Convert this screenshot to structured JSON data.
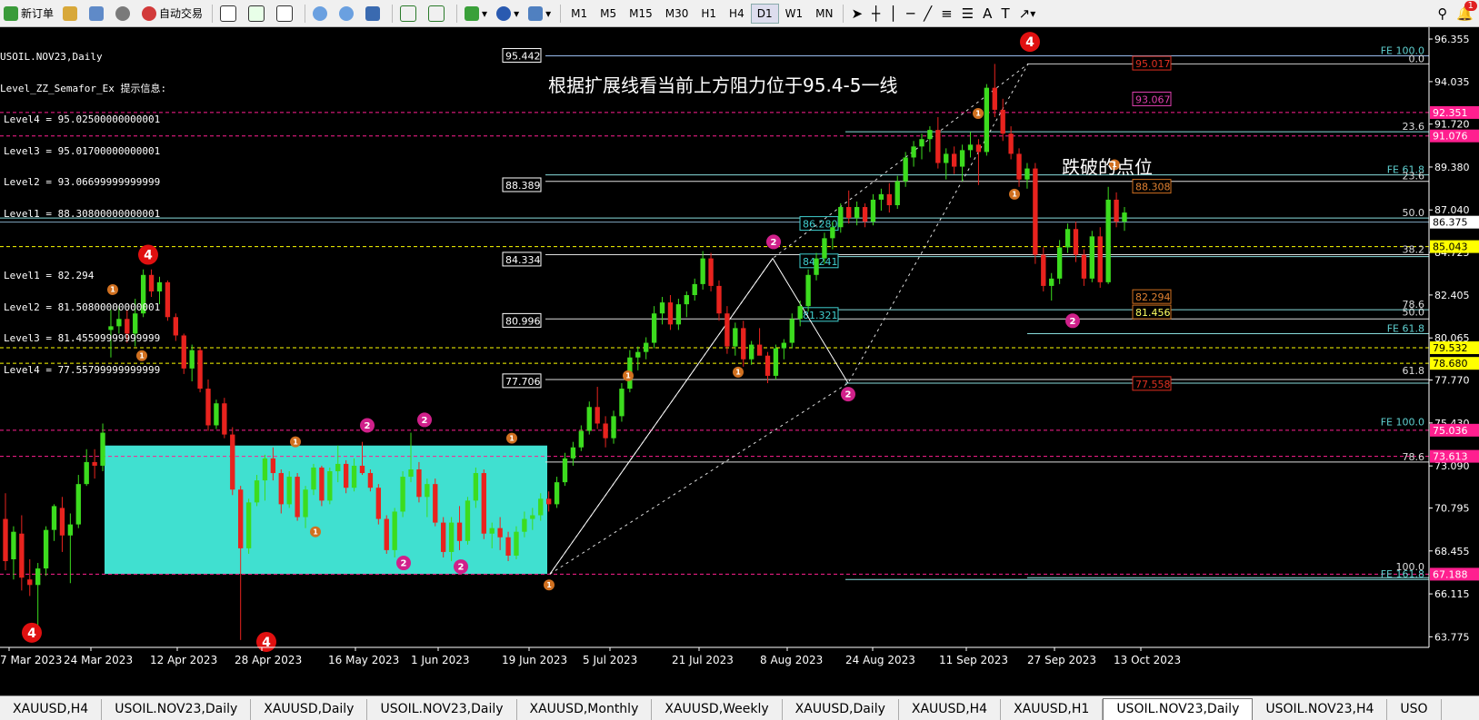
{
  "toolbar": {
    "new_order": "新订单",
    "auto_trade": "自动交易",
    "timeframes": [
      "M1",
      "M5",
      "M15",
      "M30",
      "H1",
      "H4",
      "D1",
      "W1",
      "MN"
    ],
    "active_timeframe": "D1",
    "alert_count": "1"
  },
  "info_panel": {
    "symbol": "USOIL.NOV23,Daily",
    "indicator": "Level_ZZ_Semafor_Ex 提示信息:",
    "upper_levels": [
      "Level4 = 95.02500000000001",
      "Level3 = 95.01700000000001",
      "Level2 = 93.06699999999999",
      "Level1 = 88.30800000000001"
    ],
    "lower_levels": [
      "Level1 = 82.294",
      "Level2 = 81.50800000000001",
      "Level3 = 81.45599999999999",
      "Level4 = 77.55799999999999"
    ]
  },
  "annotations": {
    "resistance_note": "根据扩展线看当前上方阻力位于95.4-5一线",
    "break_note": "跌破的点位"
  },
  "chart_data": {
    "type": "candlestick",
    "symbol": "USOIL.NOV23",
    "timeframe": "Daily",
    "ylim": [
      63.2,
      96.9
    ],
    "y_ticks": [
      "96.355",
      "94.035",
      "91.720",
      "89.380",
      "87.040",
      "84.725",
      "82.405",
      "80.065",
      "77.770",
      "75.430",
      "73.090",
      "70.795",
      "68.455",
      "66.115",
      "63.775"
    ],
    "x_ticks": [
      "7 Mar 2023",
      "24 Mar 2023",
      "12 Apr 2023",
      "28 Apr 2023",
      "16 May 2023",
      "1 Jun 2023",
      "19 Jun 2023",
      "5 Jul 2023",
      "21 Jul 2023",
      "8 Aug 2023",
      "24 Aug 2023",
      "11 Sep 2023",
      "27 Sep 2023",
      "13 Oct 2023"
    ],
    "current_price": 86.375,
    "price_tags": [
      {
        "value": "92.351",
        "color": "#ff1f8f"
      },
      {
        "value": "91.076",
        "color": "#ff1f8f"
      },
      {
        "value": "86.375",
        "color": "#ffffff"
      },
      {
        "value": "85.043",
        "color": "#ffff00"
      },
      {
        "value": "79.532",
        "color": "#ffff00"
      },
      {
        "value": "78.680",
        "color": "#ffff00"
      },
      {
        "value": "75.036",
        "color": "#ff1f8f"
      },
      {
        "value": "73.613",
        "color": "#ff1f8f"
      },
      {
        "value": "67.188",
        "color": "#ff1f8f"
      }
    ],
    "fib_labels": [
      {
        "text": "FE 100.0",
        "price": 95.45
      },
      {
        "text": "0.0",
        "price": 95.0
      },
      {
        "text": "23.6",
        "price": 91.3
      },
      {
        "text": "FE 61.8",
        "price": 88.95
      },
      {
        "text": "23.6",
        "price": 88.6
      },
      {
        "text": "50.0",
        "price": 86.6
      },
      {
        "text": "38.2",
        "price": 84.6
      },
      {
        "text": "78.6",
        "price": 81.6
      },
      {
        "text": "50.0",
        "price": 81.2
      },
      {
        "text": "FE 61.8",
        "price": 80.3
      },
      {
        "text": "61.8",
        "price": 78.0
      },
      {
        "text": "FE 100.0",
        "price": 75.2
      },
      {
        "text": "78.6",
        "price": 73.3
      },
      {
        "text": "100.0",
        "price": 67.3
      },
      {
        "text": "FE 161.8",
        "price": 66.9
      }
    ],
    "boxed_levels": [
      "95.442",
      "88.389",
      "84.334",
      "80.996",
      "77.706"
    ],
    "cyan_levels": [
      "86.280",
      "84.241",
      "81.321"
    ],
    "orange_levels": [
      "95.017",
      "88.308",
      "82.294",
      "81.456",
      "77.558"
    ],
    "magenta_levels": [
      "93.067"
    ],
    "semafor_labels": [
      "4",
      "2",
      "1"
    ],
    "candles": [
      {
        "o": 70.2,
        "h": 71.6,
        "l": 67.4,
        "c": 67.9
      },
      {
        "o": 68.0,
        "h": 69.8,
        "l": 66.9,
        "c": 69.5
      },
      {
        "o": 69.4,
        "h": 70.4,
        "l": 66.3,
        "c": 67.0
      },
      {
        "o": 66.9,
        "h": 68.0,
        "l": 66.0,
        "c": 66.6
      },
      {
        "o": 66.6,
        "h": 67.8,
        "l": 64.1,
        "c": 67.5
      },
      {
        "o": 67.5,
        "h": 69.8,
        "l": 67.1,
        "c": 69.6
      },
      {
        "o": 69.6,
        "h": 71.0,
        "l": 69.0,
        "c": 70.9
      },
      {
        "o": 70.8,
        "h": 71.4,
        "l": 68.4,
        "c": 69.3
      },
      {
        "o": 69.3,
        "h": 70.5,
        "l": 66.7,
        "c": 69.9
      },
      {
        "o": 69.9,
        "h": 72.6,
        "l": 69.7,
        "c": 72.1
      },
      {
        "o": 72.1,
        "h": 74.0,
        "l": 72.0,
        "c": 73.3
      },
      {
        "o": 73.3,
        "h": 74.0,
        "l": 72.4,
        "c": 73.1
      },
      {
        "o": 73.1,
        "h": 75.4,
        "l": 72.8,
        "c": 74.9
      },
      {
        "o": 80.5,
        "h": 81.6,
        "l": 79.0,
        "c": 80.7
      },
      {
        "o": 80.7,
        "h": 81.8,
        "l": 80.3,
        "c": 81.1
      },
      {
        "o": 81.1,
        "h": 81.6,
        "l": 79.8,
        "c": 80.3
      },
      {
        "o": 80.3,
        "h": 82.2,
        "l": 79.6,
        "c": 81.4
      },
      {
        "o": 81.4,
        "h": 83.8,
        "l": 81.2,
        "c": 83.5
      },
      {
        "o": 83.5,
        "h": 83.8,
        "l": 82.3,
        "c": 82.6
      },
      {
        "o": 82.6,
        "h": 83.4,
        "l": 81.9,
        "c": 83.1
      },
      {
        "o": 83.1,
        "h": 83.2,
        "l": 81.0,
        "c": 81.2
      },
      {
        "o": 81.2,
        "h": 81.4,
        "l": 79.9,
        "c": 80.2
      },
      {
        "o": 80.2,
        "h": 80.3,
        "l": 78.1,
        "c": 78.4
      },
      {
        "o": 78.4,
        "h": 79.7,
        "l": 77.7,
        "c": 79.4
      },
      {
        "o": 79.4,
        "h": 79.5,
        "l": 77.1,
        "c": 77.3
      },
      {
        "o": 77.3,
        "h": 77.8,
        "l": 75.0,
        "c": 75.3
      },
      {
        "o": 75.3,
        "h": 76.7,
        "l": 75.1,
        "c": 76.5
      },
      {
        "o": 76.5,
        "h": 76.8,
        "l": 74.6,
        "c": 74.8
      },
      {
        "o": 74.8,
        "h": 75.2,
        "l": 71.5,
        "c": 71.8
      },
      {
        "o": 71.8,
        "h": 72.0,
        "l": 63.6,
        "c": 68.6
      },
      {
        "o": 68.6,
        "h": 71.3,
        "l": 68.3,
        "c": 71.1
      },
      {
        "o": 71.1,
        "h": 72.6,
        "l": 70.9,
        "c": 72.3
      },
      {
        "o": 72.3,
        "h": 73.7,
        "l": 71.2,
        "c": 73.5
      },
      {
        "o": 73.5,
        "h": 74.1,
        "l": 72.3,
        "c": 72.7
      },
      {
        "o": 72.7,
        "h": 72.9,
        "l": 70.5,
        "c": 71.0
      },
      {
        "o": 71.0,
        "h": 72.8,
        "l": 70.8,
        "c": 72.5
      },
      {
        "o": 72.5,
        "h": 72.7,
        "l": 70.1,
        "c": 70.3
      },
      {
        "o": 70.3,
        "h": 72.0,
        "l": 69.7,
        "c": 71.8
      },
      {
        "o": 71.8,
        "h": 73.2,
        "l": 71.5,
        "c": 73.0
      },
      {
        "o": 73.0,
        "h": 73.1,
        "l": 70.9,
        "c": 71.2
      },
      {
        "o": 71.2,
        "h": 73.0,
        "l": 71.0,
        "c": 72.8
      },
      {
        "o": 72.8,
        "h": 74.2,
        "l": 72.2,
        "c": 73.2
      },
      {
        "o": 73.2,
        "h": 73.4,
        "l": 71.6,
        "c": 71.9
      },
      {
        "o": 71.9,
        "h": 73.5,
        "l": 71.7,
        "c": 73.1
      },
      {
        "o": 73.1,
        "h": 74.4,
        "l": 72.6,
        "c": 72.7
      },
      {
        "o": 72.7,
        "h": 72.9,
        "l": 71.7,
        "c": 71.9
      },
      {
        "o": 71.9,
        "h": 72.1,
        "l": 69.9,
        "c": 70.2
      },
      {
        "o": 70.2,
        "h": 70.4,
        "l": 68.3,
        "c": 68.5
      },
      {
        "o": 68.5,
        "h": 70.8,
        "l": 68.1,
        "c": 70.6
      },
      {
        "o": 70.6,
        "h": 72.8,
        "l": 70.3,
        "c": 72.5
      },
      {
        "o": 72.5,
        "h": 74.9,
        "l": 72.2,
        "c": 72.9
      },
      {
        "o": 72.9,
        "h": 73.3,
        "l": 71.1,
        "c": 71.4
      },
      {
        "o": 71.4,
        "h": 72.4,
        "l": 70.3,
        "c": 72.1
      },
      {
        "o": 72.1,
        "h": 72.4,
        "l": 69.8,
        "c": 70.0
      },
      {
        "o": 70.0,
        "h": 70.3,
        "l": 68.1,
        "c": 68.4
      },
      {
        "o": 68.4,
        "h": 70.3,
        "l": 67.9,
        "c": 70.0
      },
      {
        "o": 70.0,
        "h": 70.9,
        "l": 68.5,
        "c": 69.0
      },
      {
        "o": 69.0,
        "h": 71.4,
        "l": 68.8,
        "c": 71.2
      },
      {
        "o": 71.2,
        "h": 73.0,
        "l": 70.8,
        "c": 72.7
      },
      {
        "o": 72.7,
        "h": 72.9,
        "l": 69.1,
        "c": 69.4
      },
      {
        "o": 69.4,
        "h": 70.0,
        "l": 68.6,
        "c": 69.7
      },
      {
        "o": 69.7,
        "h": 70.3,
        "l": 68.5,
        "c": 69.2
      },
      {
        "o": 69.2,
        "h": 69.5,
        "l": 67.9,
        "c": 68.2
      },
      {
        "o": 68.2,
        "h": 69.8,
        "l": 68.0,
        "c": 69.5
      },
      {
        "o": 69.5,
        "h": 70.6,
        "l": 69.2,
        "c": 70.2
      },
      {
        "o": 70.2,
        "h": 70.8,
        "l": 69.6,
        "c": 70.4
      },
      {
        "o": 70.4,
        "h": 71.6,
        "l": 70.1,
        "c": 71.3
      },
      {
        "o": 71.3,
        "h": 71.7,
        "l": 70.6,
        "c": 71.0
      },
      {
        "o": 71.0,
        "h": 72.5,
        "l": 70.8,
        "c": 72.2
      },
      {
        "o": 72.2,
        "h": 73.8,
        "l": 72.0,
        "c": 73.5
      },
      {
        "o": 73.5,
        "h": 74.4,
        "l": 73.1,
        "c": 74.1
      },
      {
        "o": 74.1,
        "h": 75.3,
        "l": 73.9,
        "c": 75.0
      },
      {
        "o": 75.0,
        "h": 76.6,
        "l": 74.8,
        "c": 76.3
      },
      {
        "o": 76.3,
        "h": 77.4,
        "l": 75.1,
        "c": 75.4
      },
      {
        "o": 75.4,
        "h": 75.8,
        "l": 74.1,
        "c": 74.6
      },
      {
        "o": 74.6,
        "h": 76.1,
        "l": 74.3,
        "c": 75.8
      },
      {
        "o": 75.8,
        "h": 77.6,
        "l": 75.5,
        "c": 77.3
      },
      {
        "o": 77.3,
        "h": 79.4,
        "l": 77.1,
        "c": 79.0
      },
      {
        "o": 79.0,
        "h": 79.6,
        "l": 78.3,
        "c": 79.3
      },
      {
        "o": 79.3,
        "h": 80.1,
        "l": 78.9,
        "c": 79.8
      },
      {
        "o": 79.8,
        "h": 81.8,
        "l": 79.5,
        "c": 81.4
      },
      {
        "o": 81.4,
        "h": 82.3,
        "l": 80.8,
        "c": 82.0
      },
      {
        "o": 82.0,
        "h": 82.4,
        "l": 80.5,
        "c": 80.8
      },
      {
        "o": 80.8,
        "h": 82.2,
        "l": 80.5,
        "c": 81.9
      },
      {
        "o": 81.9,
        "h": 82.6,
        "l": 81.2,
        "c": 82.4
      },
      {
        "o": 82.4,
        "h": 83.3,
        "l": 82.1,
        "c": 83.0
      },
      {
        "o": 83.0,
        "h": 84.8,
        "l": 82.7,
        "c": 84.4
      },
      {
        "o": 84.4,
        "h": 84.7,
        "l": 82.6,
        "c": 82.9
      },
      {
        "o": 82.9,
        "h": 83.2,
        "l": 81.0,
        "c": 81.4
      },
      {
        "o": 81.4,
        "h": 81.8,
        "l": 79.2,
        "c": 79.6
      },
      {
        "o": 79.6,
        "h": 80.9,
        "l": 79.1,
        "c": 80.6
      },
      {
        "o": 80.6,
        "h": 81.0,
        "l": 78.5,
        "c": 78.9
      },
      {
        "o": 78.9,
        "h": 79.9,
        "l": 78.6,
        "c": 79.7
      },
      {
        "o": 79.7,
        "h": 80.6,
        "l": 79.4,
        "c": 79.1
      },
      {
        "o": 79.1,
        "h": 79.3,
        "l": 77.6,
        "c": 78.0
      },
      {
        "o": 78.0,
        "h": 79.7,
        "l": 77.8,
        "c": 79.5
      },
      {
        "o": 79.5,
        "h": 80.0,
        "l": 78.9,
        "c": 79.8
      },
      {
        "o": 79.8,
        "h": 81.4,
        "l": 79.5,
        "c": 81.1
      },
      {
        "o": 81.1,
        "h": 82.1,
        "l": 80.7,
        "c": 81.8
      },
      {
        "o": 81.8,
        "h": 83.8,
        "l": 81.5,
        "c": 83.5
      },
      {
        "o": 83.5,
        "h": 84.7,
        "l": 83.2,
        "c": 84.4
      },
      {
        "o": 84.4,
        "h": 85.8,
        "l": 84.1,
        "c": 85.5
      },
      {
        "o": 85.5,
        "h": 86.4,
        "l": 84.9,
        "c": 86.1
      },
      {
        "o": 86.1,
        "h": 87.4,
        "l": 85.8,
        "c": 87.2
      },
      {
        "o": 87.2,
        "h": 88.1,
        "l": 86.3,
        "c": 86.6
      },
      {
        "o": 86.6,
        "h": 87.5,
        "l": 86.2,
        "c": 87.2
      },
      {
        "o": 87.2,
        "h": 87.4,
        "l": 86.1,
        "c": 86.4
      },
      {
        "o": 86.4,
        "h": 87.9,
        "l": 86.2,
        "c": 87.6
      },
      {
        "o": 87.6,
        "h": 88.2,
        "l": 87.0,
        "c": 87.9
      },
      {
        "o": 87.9,
        "h": 88.5,
        "l": 86.9,
        "c": 87.3
      },
      {
        "o": 87.3,
        "h": 88.9,
        "l": 87.1,
        "c": 88.6
      },
      {
        "o": 88.6,
        "h": 90.2,
        "l": 88.3,
        "c": 89.9
      },
      {
        "o": 89.9,
        "h": 90.8,
        "l": 89.4,
        "c": 90.5
      },
      {
        "o": 90.5,
        "h": 91.2,
        "l": 89.8,
        "c": 90.9
      },
      {
        "o": 90.9,
        "h": 91.6,
        "l": 90.2,
        "c": 91.4
      },
      {
        "o": 91.4,
        "h": 92.1,
        "l": 89.3,
        "c": 89.6
      },
      {
        "o": 89.6,
        "h": 90.4,
        "l": 88.7,
        "c": 90.1
      },
      {
        "o": 90.1,
        "h": 90.5,
        "l": 89.0,
        "c": 89.4
      },
      {
        "o": 89.4,
        "h": 90.6,
        "l": 88.6,
        "c": 90.3
      },
      {
        "o": 90.3,
        "h": 91.3,
        "l": 89.9,
        "c": 90.6
      },
      {
        "o": 90.6,
        "h": 90.9,
        "l": 88.4,
        "c": 90.2
      },
      {
        "o": 90.2,
        "h": 93.9,
        "l": 90.0,
        "c": 93.7
      },
      {
        "o": 93.7,
        "h": 95.0,
        "l": 92.1,
        "c": 92.5
      },
      {
        "o": 92.5,
        "h": 93.1,
        "l": 90.8,
        "c": 91.2
      },
      {
        "o": 91.2,
        "h": 91.6,
        "l": 89.8,
        "c": 90.1
      },
      {
        "o": 90.1,
        "h": 90.4,
        "l": 88.3,
        "c": 88.7
      },
      {
        "o": 88.7,
        "h": 89.6,
        "l": 88.2,
        "c": 89.3
      },
      {
        "o": 89.3,
        "h": 89.6,
        "l": 84.1,
        "c": 84.6
      },
      {
        "o": 84.6,
        "h": 85.0,
        "l": 82.6,
        "c": 82.9
      },
      {
        "o": 82.9,
        "h": 83.6,
        "l": 82.1,
        "c": 83.3
      },
      {
        "o": 83.3,
        "h": 85.4,
        "l": 83.0,
        "c": 85.0
      },
      {
        "o": 85.0,
        "h": 86.3,
        "l": 84.7,
        "c": 86.0
      },
      {
        "o": 86.0,
        "h": 86.4,
        "l": 84.2,
        "c": 84.6
      },
      {
        "o": 84.6,
        "h": 84.9,
        "l": 82.9,
        "c": 83.3
      },
      {
        "o": 83.3,
        "h": 85.9,
        "l": 83.1,
        "c": 85.6
      },
      {
        "o": 85.6,
        "h": 86.1,
        "l": 82.8,
        "c": 83.1
      },
      {
        "o": 83.1,
        "h": 88.3,
        "l": 83.0,
        "c": 87.6
      },
      {
        "o": 87.6,
        "h": 88.0,
        "l": 86.1,
        "c": 86.4
      },
      {
        "o": 86.4,
        "h": 87.2,
        "l": 85.9,
        "c": 86.9
      }
    ]
  },
  "tabs": {
    "items": [
      "XAUUSD,H4",
      "USOIL.NOV23,Daily",
      "XAUUSD,Daily",
      "USOIL.NOV23,Daily",
      "XAUUSD,Monthly",
      "XAUUSD,Weekly",
      "XAUUSD,Daily",
      "XAUUSD,H4",
      "XAUUSD,H1",
      "USOIL.NOV23,Daily",
      "USOIL.NOV23,H4",
      "USO"
    ],
    "active_index": 9
  }
}
